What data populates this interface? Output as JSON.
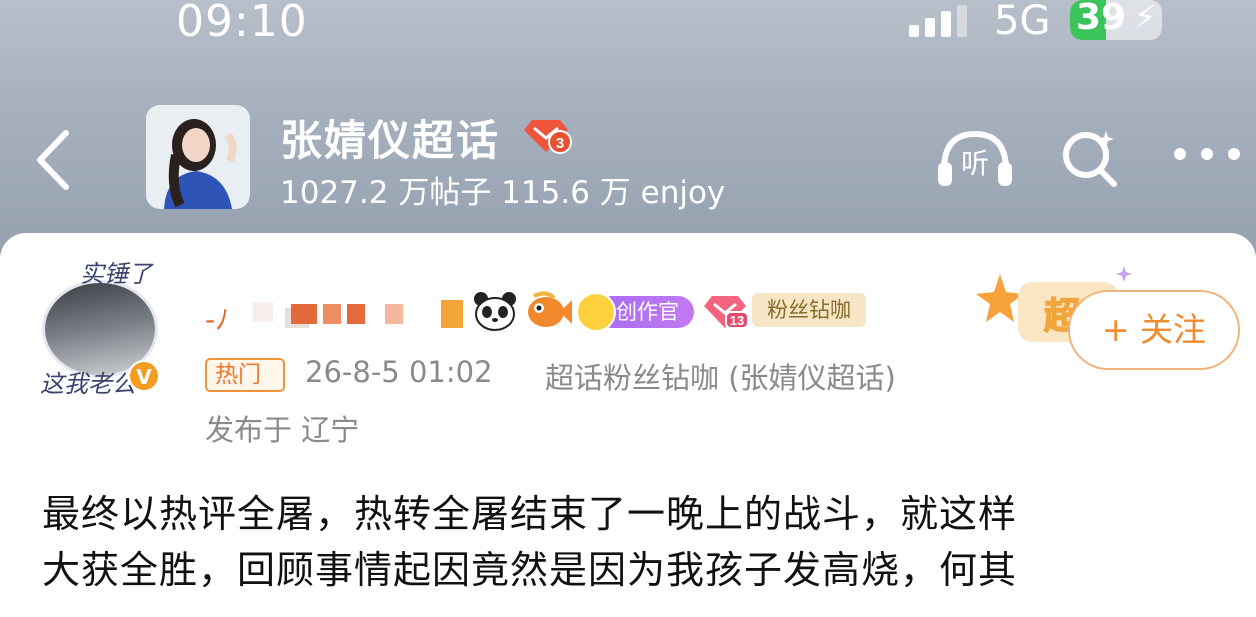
{
  "status_bar": {
    "time": "09:10",
    "network": "5G",
    "battery_level": "39",
    "battery_fraction": 0.39,
    "battery_color": "#3ac45a"
  },
  "header": {
    "back_icon": "chevron-left-icon",
    "title": "张婧仪超话",
    "rank_badge_text": "3",
    "stats": "1027.2 万帖子 115.6 万 enjoy",
    "listen_label": "听",
    "search_icon": "search-icon",
    "more_icon": "more-icon"
  },
  "post": {
    "author": {
      "frame_top_text": "实锤了",
      "frame_bottom_text": "这我老公",
      "verified_label": "V"
    },
    "badges": {
      "panda_icon": "panda-emoji-icon",
      "fish_icon": "fish-emoji-icon",
      "creator_label": "创作官",
      "level_number": "13",
      "fan_label": "粉丝钻咖"
    },
    "super_deco_text": "超",
    "follow_label": "+ 关注",
    "hot_tag": "热门",
    "timestamp": "26-8-5 01:02",
    "source": "超话粉丝钻咖 (张婧仪超话)",
    "location": "发布于 辽宁",
    "text_lines": [
      "最终以热评全屠，热转全屠结束了一晚上的战斗，就这样",
      "大获全胜，回顾事情起因竟然是因为我孩子发高烧，何其"
    ]
  },
  "colors": {
    "accent_orange": "#ec8d30",
    "creator_purple": "#a66cf3",
    "fan_badge_bg": "#f6e6c6"
  }
}
